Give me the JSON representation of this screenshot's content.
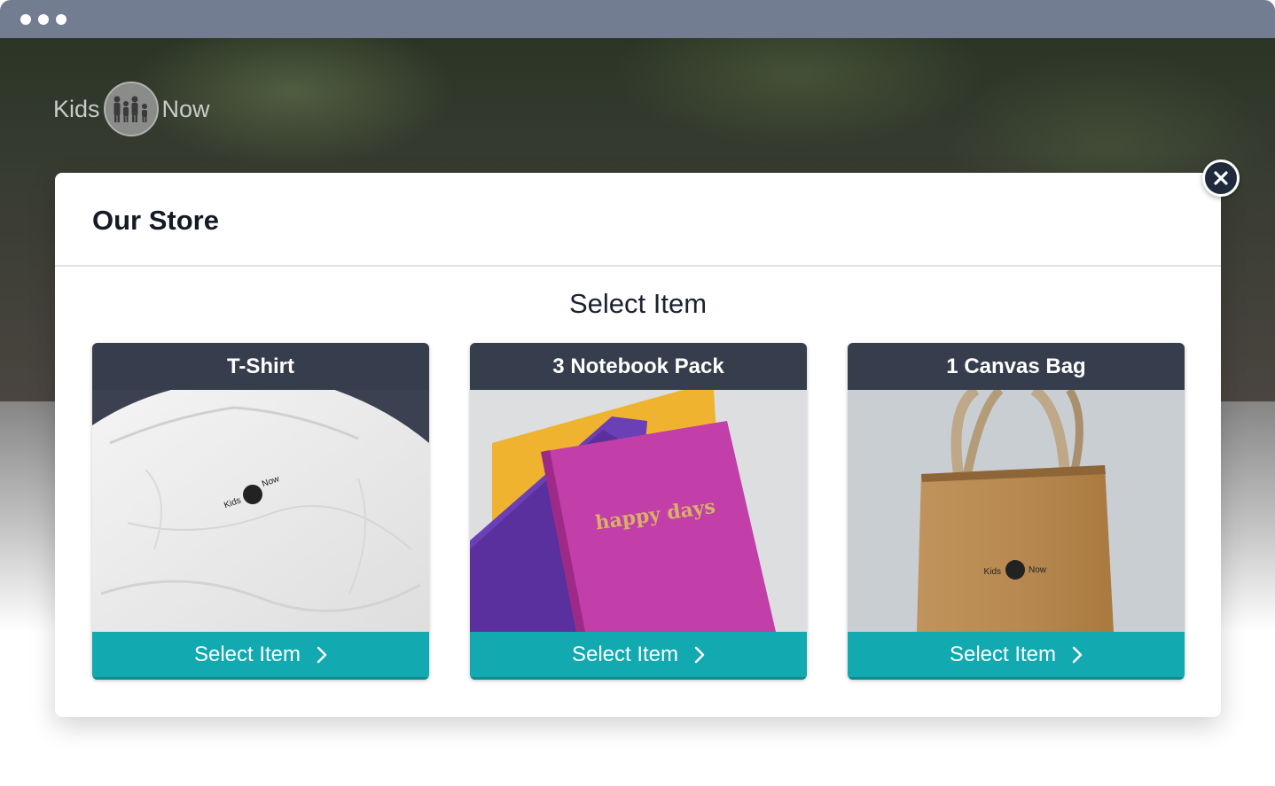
{
  "window": {
    "controls": [
      "dot",
      "dot",
      "dot"
    ]
  },
  "logo": {
    "left_text": "Kids",
    "right_text": "Now"
  },
  "modal": {
    "title": "Our Store",
    "subtitle": "Select Item",
    "close_icon": "close-icon"
  },
  "products": [
    {
      "name": "T-Shirt",
      "button": "Select Item",
      "print_left": "Kids",
      "print_right": "Now"
    },
    {
      "name": "3 Notebook Pack",
      "button": "Select Item",
      "cover_text": "happy days"
    },
    {
      "name": "1 Canvas Bag",
      "button": "Select Item",
      "print_left": "Kids",
      "print_right": "Now"
    }
  ],
  "colors": {
    "titlebar": "#737d92",
    "card_header": "#363d4c",
    "accent": "#12a9b0",
    "close_button": "#1f2a3d"
  }
}
